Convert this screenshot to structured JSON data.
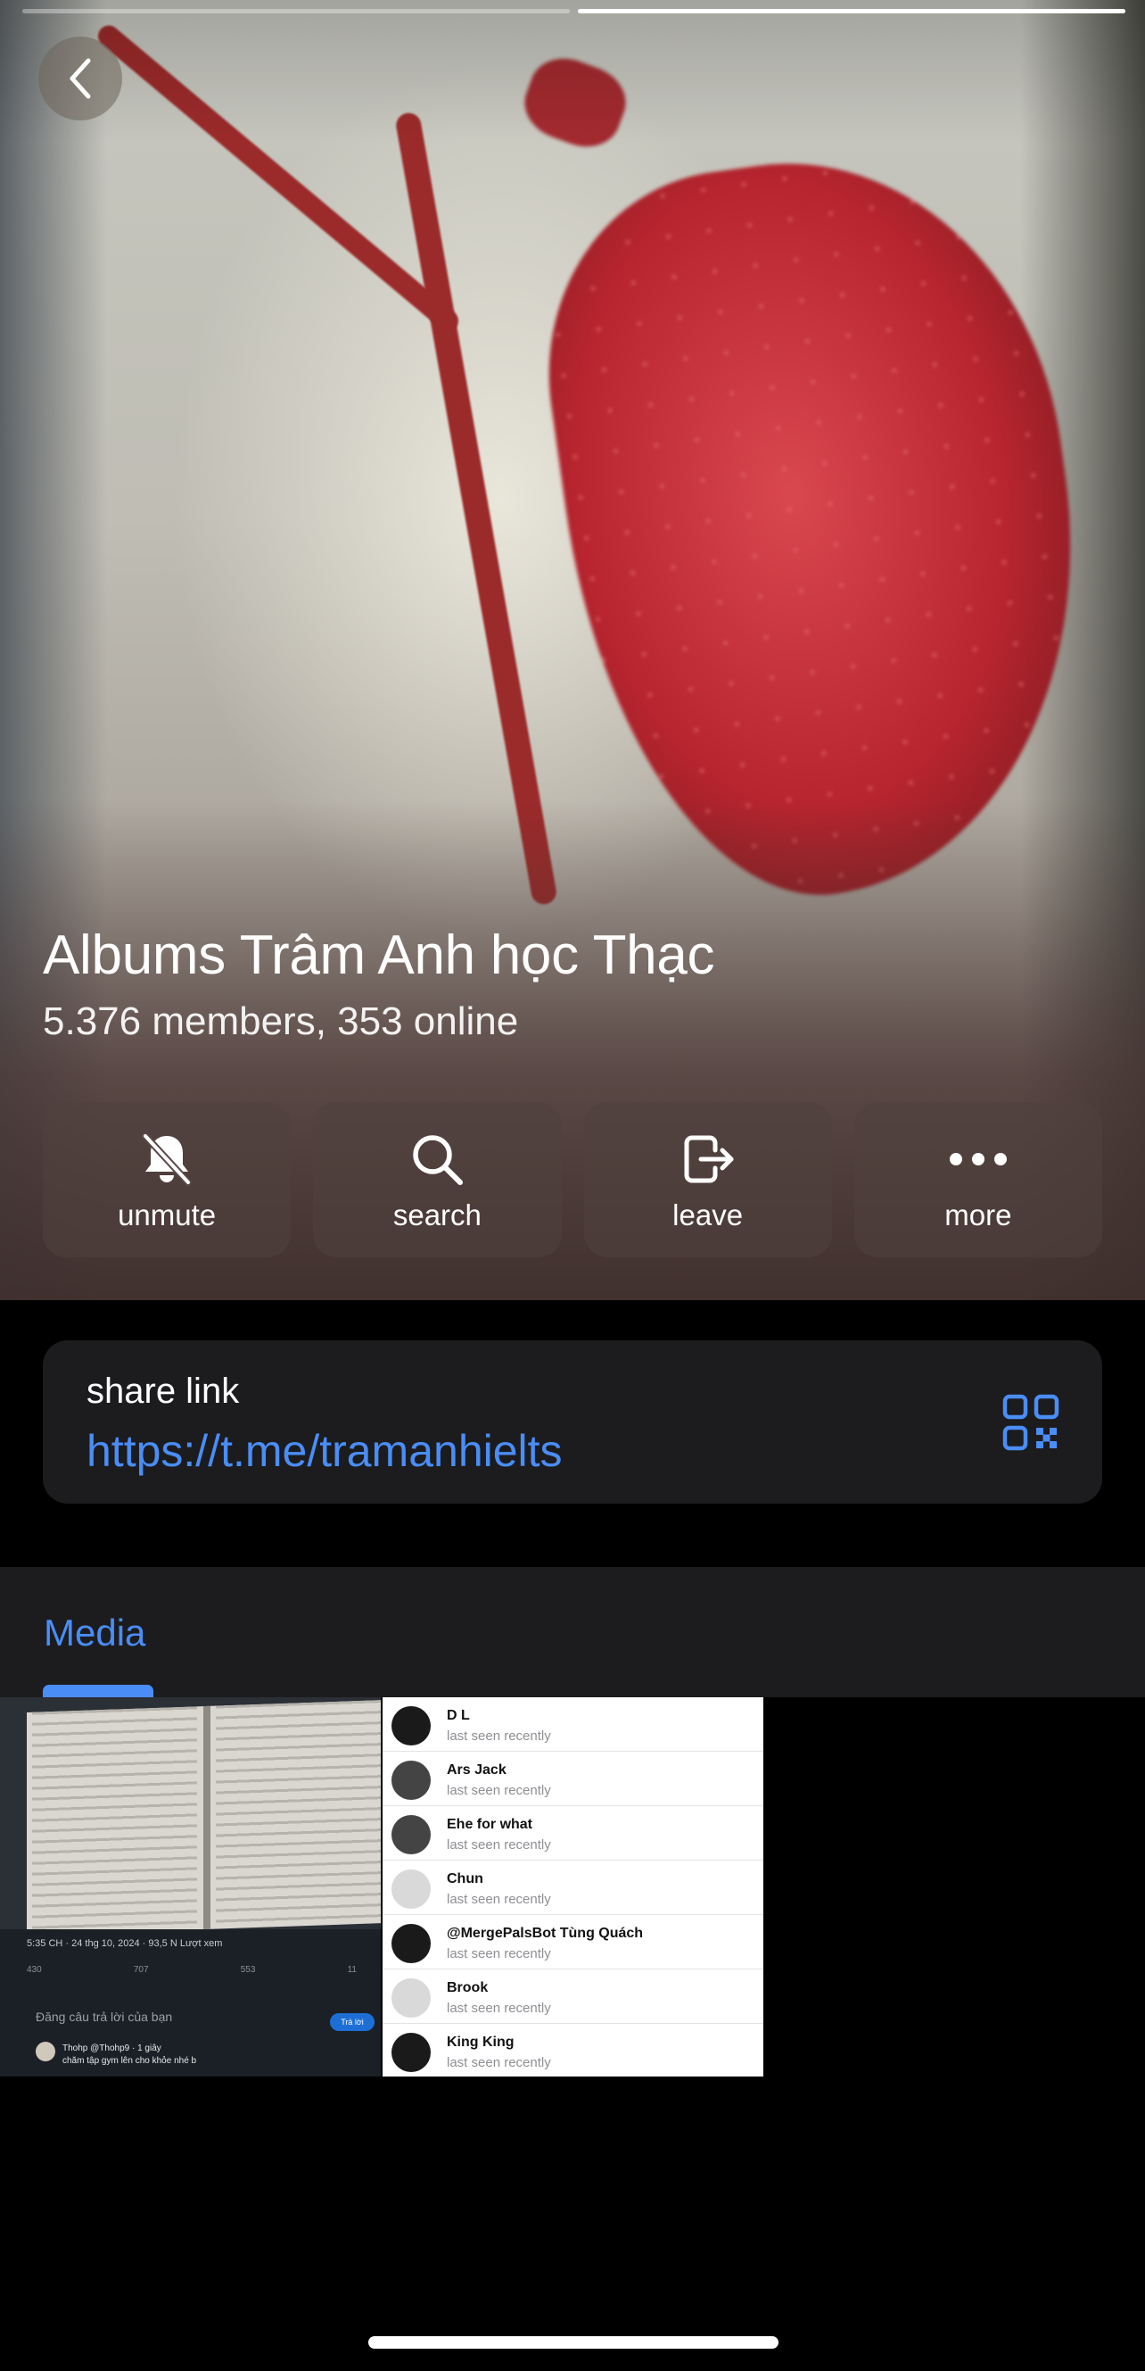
{
  "group": {
    "title": "Albums Trâm Anh học Thạc",
    "subtitle": "5.376 members, 353 online"
  },
  "actions": [
    {
      "label": "unmute",
      "icon": "bell-slash-icon"
    },
    {
      "label": "search",
      "icon": "search-icon"
    },
    {
      "label": "leave",
      "icon": "leave-icon"
    },
    {
      "label": "more",
      "icon": "more-icon"
    }
  ],
  "share": {
    "caption": "share link",
    "url": "https://t.me/tramanhielts",
    "icon": "qr-code-icon"
  },
  "media": {
    "tab_label": "Media",
    "thumb1": {
      "meta": "5:35 CH · 24 thg 10, 2024 · 93,5 N Lượt xem",
      "stats": [
        "430",
        "707",
        "553",
        "11"
      ],
      "reply_prompt": "Đăng câu trả lời của bạn",
      "reply_button": "Trả lời",
      "comment_name": "Thohp @Thohp9 · 1 giây",
      "comment_text": "chăm tập gym lên cho khỏe nhé b"
    },
    "members": [
      {
        "name": "D L",
        "status": "last seen recently"
      },
      {
        "name": "Ars Jack",
        "status": "last seen recently"
      },
      {
        "name": "Ehe for what",
        "status": "last seen recently"
      },
      {
        "name": "Chun",
        "status": "last seen recently"
      },
      {
        "name": "@MergePalsBot Tùng Quách",
        "status": "last seen recently"
      },
      {
        "name": "Brook",
        "status": "last seen recently"
      },
      {
        "name": "King King",
        "status": "last seen recently"
      }
    ]
  },
  "colors": {
    "accent": "#4a8df6",
    "card": "#1c1c1e",
    "background": "#000000"
  }
}
